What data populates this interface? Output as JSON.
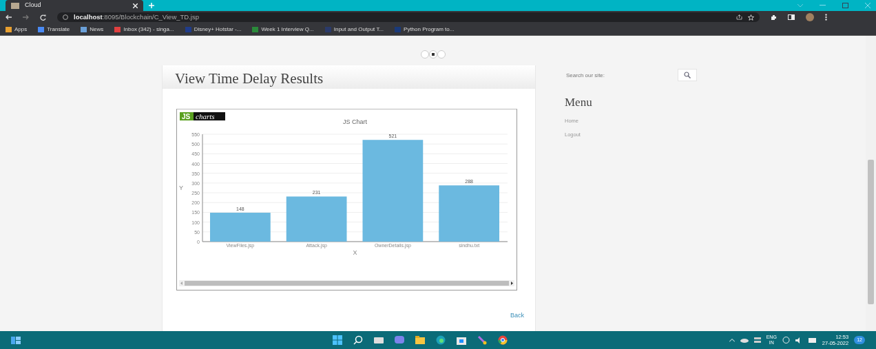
{
  "browser": {
    "tab_title": "Cloud",
    "url": "**localhost**:8095/Blockchain/C_View_TD.jsp",
    "bookmarks": [
      {
        "label": "Apps",
        "color": "#e8a030"
      },
      {
        "label": "Translate",
        "color": "#4a8af4"
      },
      {
        "label": "News",
        "color": "#6aa0d8"
      },
      {
        "label": "Inbox (342) - singa...",
        "color": "#e04040"
      },
      {
        "label": "Disney+ Hotstar -...",
        "color": "#1f3c8a"
      },
      {
        "label": "Week 1 Interview Q...",
        "color": "#2a8a3a"
      },
      {
        "label": "Input and Output T...",
        "color": "#2a3a6a"
      },
      {
        "label": "Python Program to...",
        "color": "#1a3a7a"
      }
    ]
  },
  "carousel": [
    {
      "selected": false
    },
    {
      "selected": true
    },
    {
      "selected": false
    }
  ],
  "main": {
    "heading": "View Time Delay Results",
    "chart_logo": [
      "JS",
      "charts"
    ],
    "chart_data": {
      "type": "bar",
      "title": "JS Chart",
      "xlabel": "X",
      "ylabel": "Y",
      "categories": [
        "ViewFiles.jsp",
        "Attack.jsp",
        "OwnerDetails.jsp",
        "sindhu.txt"
      ],
      "series": [
        {
          "color": "#6bb9e0",
          "values": [
            148,
            231,
            521,
            288
          ]
        }
      ],
      "grid": true,
      "ylim": [
        0,
        550
      ],
      "yticks": [
        0,
        50,
        100,
        150,
        200,
        250,
        300,
        350,
        400,
        450,
        500,
        550
      ],
      "data_labels": true
    },
    "back_link": "Back"
  },
  "sidebar": {
    "search_placeholder": "Search our site:",
    "menu_heading": "Menu",
    "menu_items": [
      "Home",
      "Logout"
    ]
  },
  "taskbar": {
    "language": [
      "ENG",
      "IN"
    ],
    "time": "12:53",
    "date": "27-05-2022",
    "notifications": "12"
  }
}
